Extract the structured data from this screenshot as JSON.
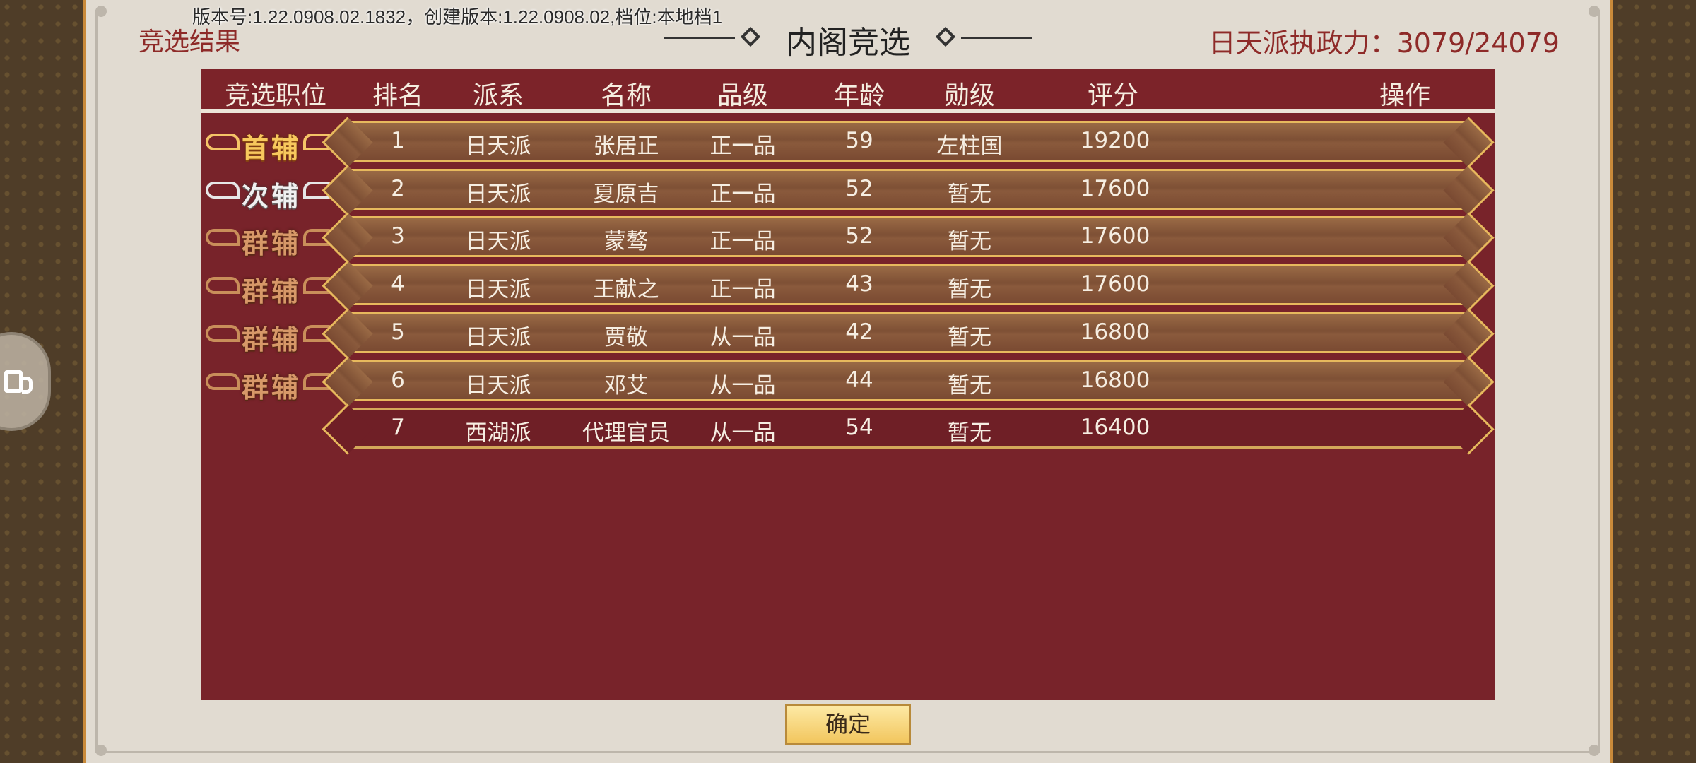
{
  "version_text": "版本号:1.22.0908.02.1832，创建版本:1.22.0908.02,档位:本地档1",
  "result_label": "竞选结果",
  "title": "内阁竞选",
  "power_label": "日天派执政力：3079/24079",
  "columns": [
    "竞选职位",
    "排名",
    "派系",
    "名称",
    "品级",
    "年龄",
    "勋级",
    "评分",
    "操作"
  ],
  "rows": [
    {
      "position": "首辅",
      "badge": "gold",
      "rank": "1",
      "faction": "日天派",
      "name": "张居正",
      "grade": "正一品",
      "age": "59",
      "merit": "左柱国",
      "score": "19200"
    },
    {
      "position": "次辅",
      "badge": "silver",
      "rank": "2",
      "faction": "日天派",
      "name": "夏原吉",
      "grade": "正一品",
      "age": "52",
      "merit": "暂无",
      "score": "17600"
    },
    {
      "position": "群辅",
      "badge": "bronze",
      "rank": "3",
      "faction": "日天派",
      "name": "蒙骜",
      "grade": "正一品",
      "age": "52",
      "merit": "暂无",
      "score": "17600"
    },
    {
      "position": "群辅",
      "badge": "bronze",
      "rank": "4",
      "faction": "日天派",
      "name": "王献之",
      "grade": "正一品",
      "age": "43",
      "merit": "暂无",
      "score": "17600"
    },
    {
      "position": "群辅",
      "badge": "bronze",
      "rank": "5",
      "faction": "日天派",
      "name": "贾敬",
      "grade": "从一品",
      "age": "42",
      "merit": "暂无",
      "score": "16800"
    },
    {
      "position": "群辅",
      "badge": "bronze",
      "rank": "6",
      "faction": "日天派",
      "name": "邓艾",
      "grade": "从一品",
      "age": "44",
      "merit": "暂无",
      "score": "16800"
    },
    {
      "position": "",
      "badge": "none",
      "rank": "7",
      "faction": "西湖派",
      "name": "代理官员",
      "grade": "从一品",
      "age": "54",
      "merit": "暂无",
      "score": "16400"
    }
  ],
  "confirm_label": "确定",
  "colors": {
    "accent_red": "#8e2a28",
    "table_bg": "#78232a",
    "gold": "#e7b95d"
  }
}
